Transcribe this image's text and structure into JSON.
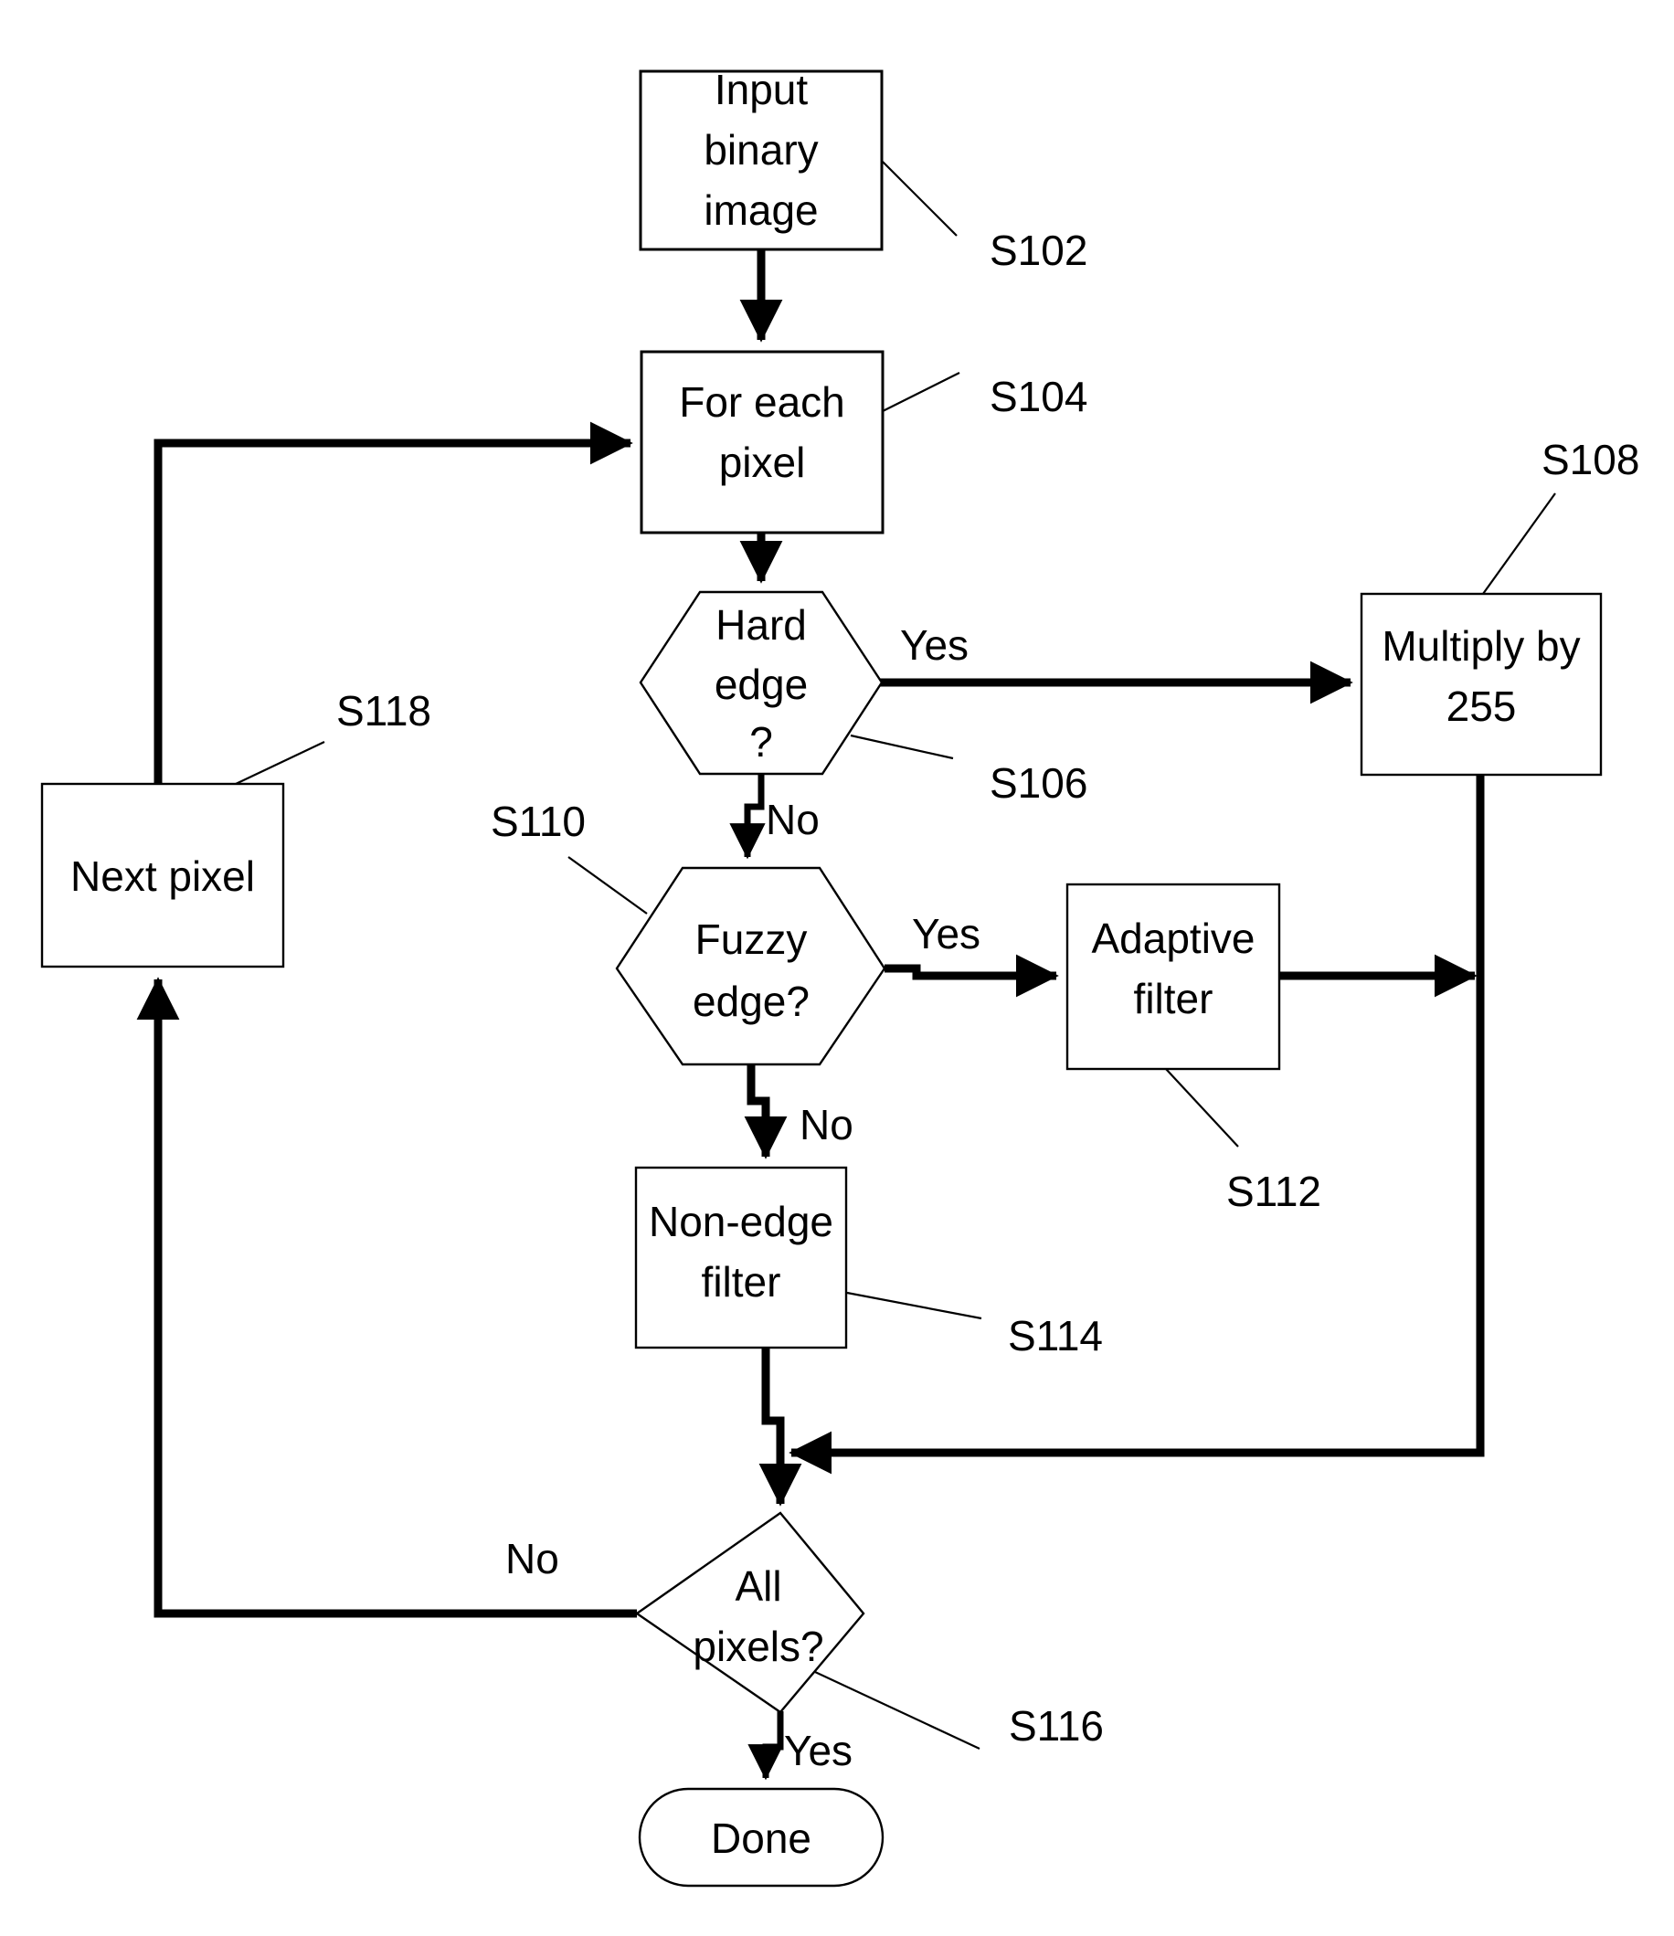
{
  "diagram": {
    "title": "Binary image edge-aware filtering flowchart",
    "stroke_color": "#000000",
    "fill_color": "#ffffff"
  },
  "nodes": {
    "input": {
      "label_line1": "Input",
      "label_line2": "binary",
      "label_line3": "image",
      "ref": "S102",
      "shape": "process-box"
    },
    "for_each": {
      "label_line1": "For each",
      "label_line2": "pixel",
      "ref": "S104",
      "shape": "process-box"
    },
    "hard_edge": {
      "label_line1": "Hard",
      "label_line2": "edge",
      "label_line3": "?",
      "ref": "S106",
      "shape": "hexagon"
    },
    "multiply": {
      "label_line1": "Multiply by",
      "label_line2": "255",
      "ref": "S108",
      "shape": "process-box"
    },
    "fuzzy_edge": {
      "label_line1": "Fuzzy",
      "label_line2": "edge?",
      "ref": "S110",
      "shape": "hexagon"
    },
    "adaptive": {
      "label_line1": "Adaptive",
      "label_line2": "filter",
      "ref": "S112",
      "shape": "process-box"
    },
    "non_edge": {
      "label_line1": "Non-edge",
      "label_line2": "filter",
      "ref": "S114",
      "shape": "process-box"
    },
    "all_pixels": {
      "label_line1": "All",
      "label_line2": "pixels?",
      "ref": "S116",
      "shape": "diamond"
    },
    "next_pixel": {
      "label_line1": "Next pixel",
      "ref": "S118",
      "shape": "process-box"
    },
    "done": {
      "label_line1": "Done",
      "shape": "terminator"
    }
  },
  "branch_labels": {
    "hard_edge_yes": "Yes",
    "hard_edge_no": "No",
    "fuzzy_edge_yes": "Yes",
    "fuzzy_edge_no": "No",
    "all_pixels_no": "No",
    "all_pixels_yes": "Yes"
  }
}
